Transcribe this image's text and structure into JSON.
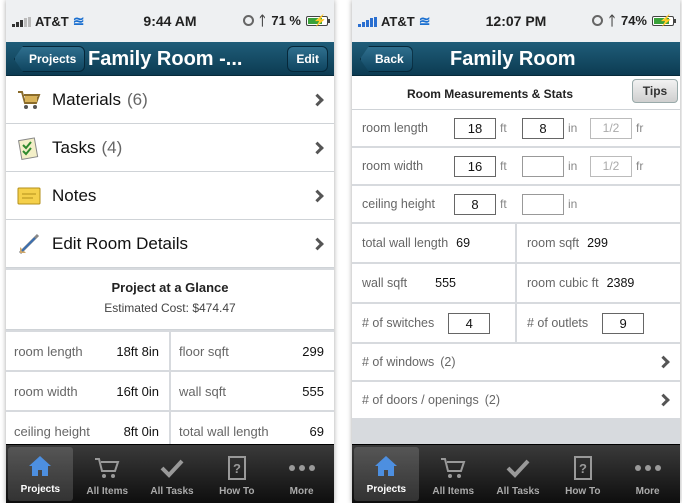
{
  "left": {
    "status": {
      "carrier": "AT&T",
      "time": "9:44 AM",
      "battery": "71 %"
    },
    "nav": {
      "back_label": "Projects",
      "title": "Family Room -...",
      "edit_label": "Edit"
    },
    "menu": [
      {
        "label": "Materials",
        "count": "(6)",
        "icon": "shopping-cart-icon"
      },
      {
        "label": "Tasks",
        "count": "(4)",
        "icon": "checklist-icon"
      },
      {
        "label": "Notes",
        "count": "",
        "icon": "note-icon"
      },
      {
        "label": "Edit Room Details",
        "count": "",
        "icon": "ruler-pencil-icon"
      }
    ],
    "glance": {
      "title": "Project at a Glance",
      "cost": "Estimated Cost: $474.47"
    },
    "stats": [
      {
        "label": "room length",
        "value": "18ft 8in"
      },
      {
        "label": "floor sqft",
        "value": "299"
      },
      {
        "label": "room width",
        "value": "16ft 0in"
      },
      {
        "label": "wall sqft",
        "value": "555"
      },
      {
        "label": "ceiling height",
        "value": "8ft 0in"
      },
      {
        "label": "total wall length",
        "value": "69"
      }
    ]
  },
  "right": {
    "status": {
      "carrier": "AT&T",
      "time": "12:07 PM",
      "battery": "74%"
    },
    "nav": {
      "back_label": "Back",
      "title": "Family Room"
    },
    "section": {
      "title": "Room Measurements & Stats",
      "tips_label": "Tips"
    },
    "measurements": [
      {
        "label": "room length",
        "ft": "18",
        "in": "8",
        "fr": "1/2",
        "ft_unit": "ft",
        "in_unit": "in",
        "fr_unit": "fr"
      },
      {
        "label": "room width",
        "ft": "16",
        "in": "",
        "fr": "1/2",
        "ft_unit": "ft",
        "in_unit": "in",
        "fr_unit": "fr"
      },
      {
        "label": "ceiling height",
        "ft": "8",
        "in": "",
        "ft_unit": "ft",
        "in_unit": "in"
      }
    ],
    "stats": [
      {
        "label": "total wall length",
        "value": "69"
      },
      {
        "label": "room sqft",
        "value": "299"
      },
      {
        "label": "wall sqft",
        "value": "555"
      },
      {
        "label": "room cubic ft",
        "value": "2389"
      }
    ],
    "switches": {
      "label": "# of switches",
      "value": "4"
    },
    "outlets": {
      "label": "# of outlets",
      "value": "9"
    },
    "links": [
      {
        "label": "# of windows",
        "count": "(2)"
      },
      {
        "label": "# of doors / openings",
        "count": "(2)"
      }
    ]
  },
  "tabs": [
    {
      "label": "Projects",
      "icon": "house-icon"
    },
    {
      "label": "All Items",
      "icon": "cart-icon"
    },
    {
      "label": "All Tasks",
      "icon": "checkmark-icon"
    },
    {
      "label": "How To",
      "icon": "help-book-icon"
    },
    {
      "label": "More",
      "icon": "more-dots-icon"
    }
  ],
  "colors": {
    "nav": "#0c3b52",
    "tabbar": "#1a1a1a",
    "background": "#d7dade"
  }
}
